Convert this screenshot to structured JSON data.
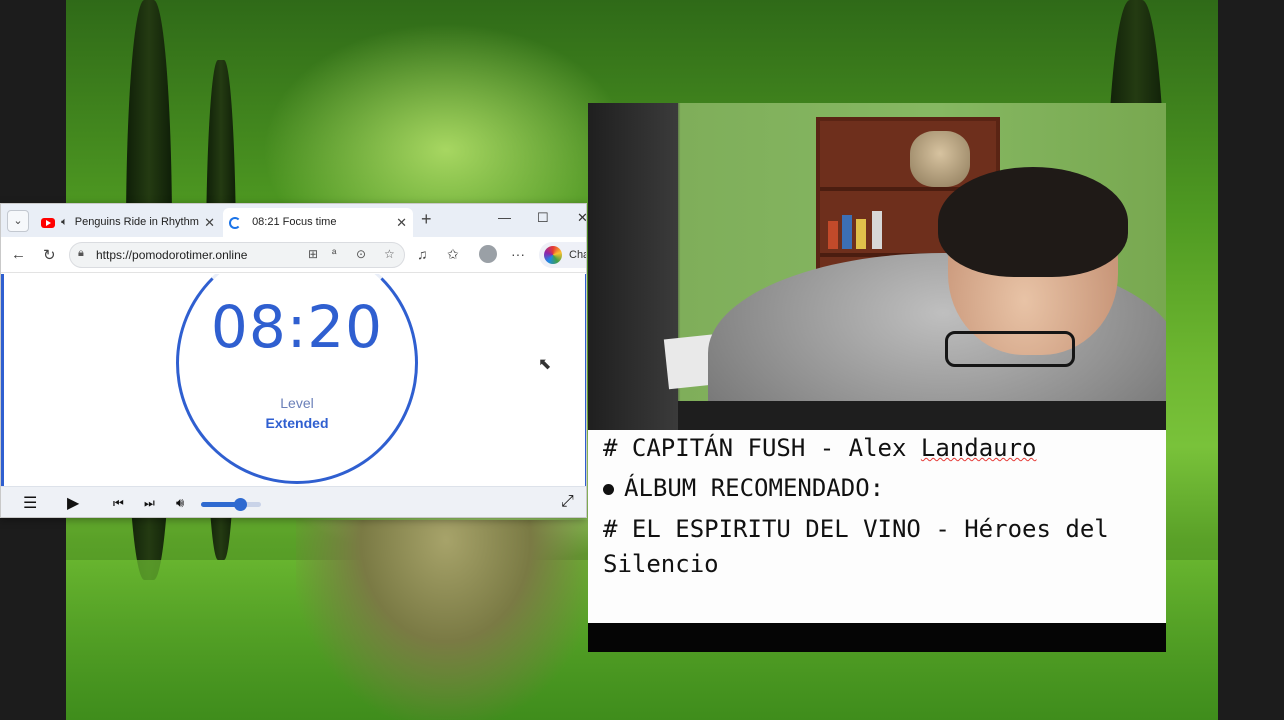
{
  "browser": {
    "tabs": [
      {
        "title": "Penguins Ride in Rhythm",
        "icon": "youtube-icon",
        "audio_icon": "speaker-icon",
        "active": false
      },
      {
        "title": "08:21 Focus time",
        "icon": "loading-icon",
        "active": true
      }
    ],
    "url": "https://pomodorotimer.online",
    "copilot_label": "Chat"
  },
  "pomodoro": {
    "time": "08:20",
    "level_label": "Level",
    "level_value": "Extended"
  },
  "player": {
    "volume": 0.65
  },
  "caption": {
    "line1_prefix": "# CAPITÁN FUSH - Alex ",
    "line1_name": "Landauro",
    "bullet": "ÁLBUM RECOMENDADO:",
    "line3": "# EL ESPIRITU DEL VINO - Héroes del Silencio"
  },
  "colors": {
    "accent": "#2f5fd0",
    "forest": "#5aa128"
  }
}
